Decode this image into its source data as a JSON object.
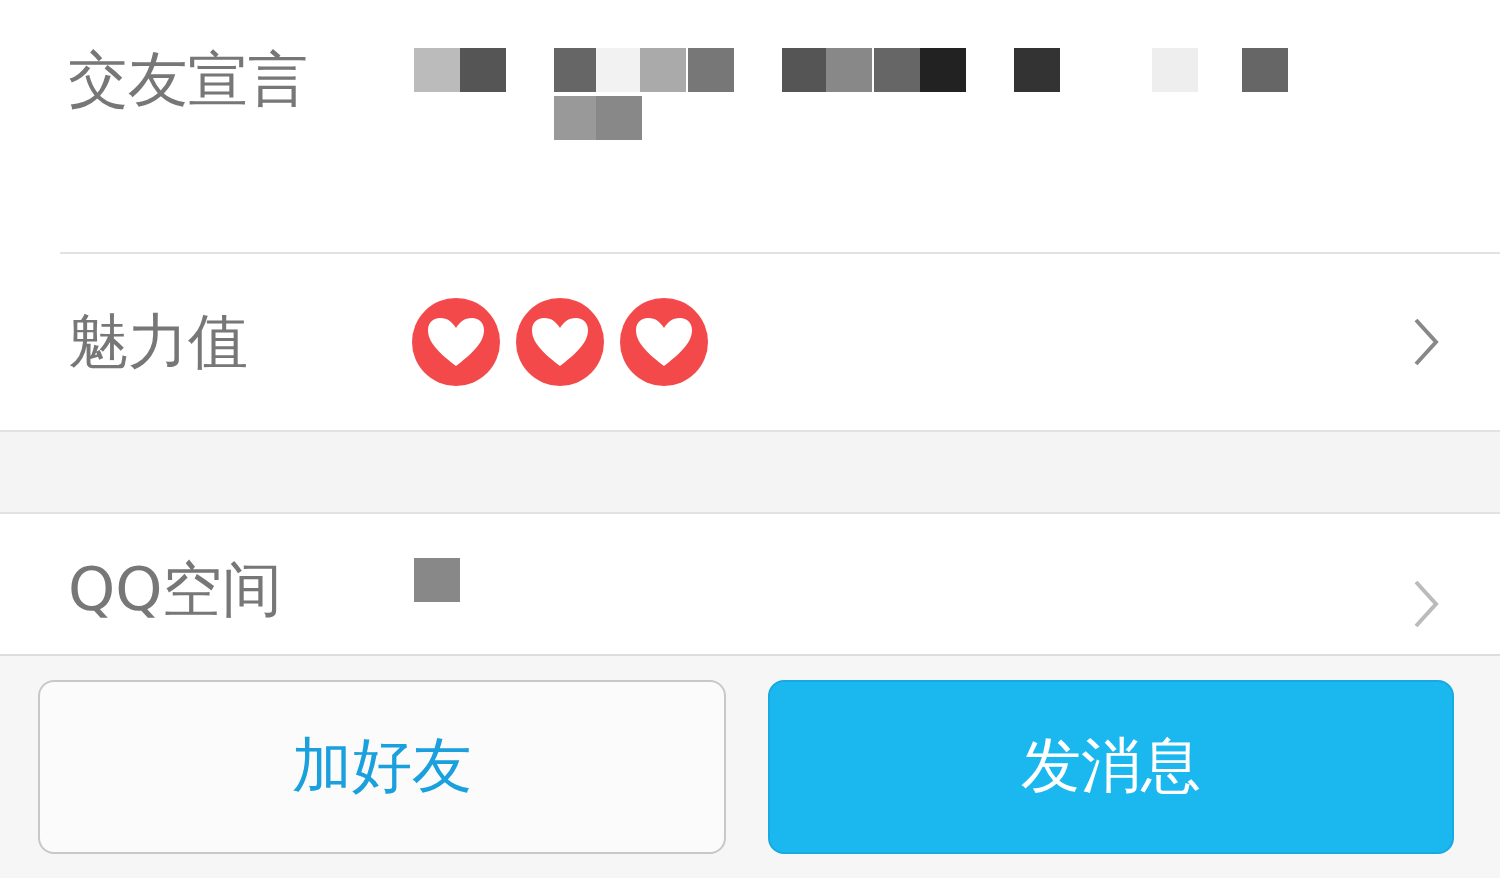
{
  "rows": [
    {
      "kind": "text",
      "label": "交友宣言"
    },
    {
      "kind": "rating",
      "label": "魅力值",
      "hearts": [
        {
          "filled": true
        },
        {
          "filled": true
        },
        {
          "filled": true
        }
      ]
    },
    {
      "kind": "gap"
    },
    {
      "kind": "link",
      "label": "QQ空间"
    }
  ],
  "buttons": [
    {
      "label": "加好友",
      "kind": "secondary"
    },
    {
      "label": "发消息",
      "kind": "primary"
    }
  ]
}
